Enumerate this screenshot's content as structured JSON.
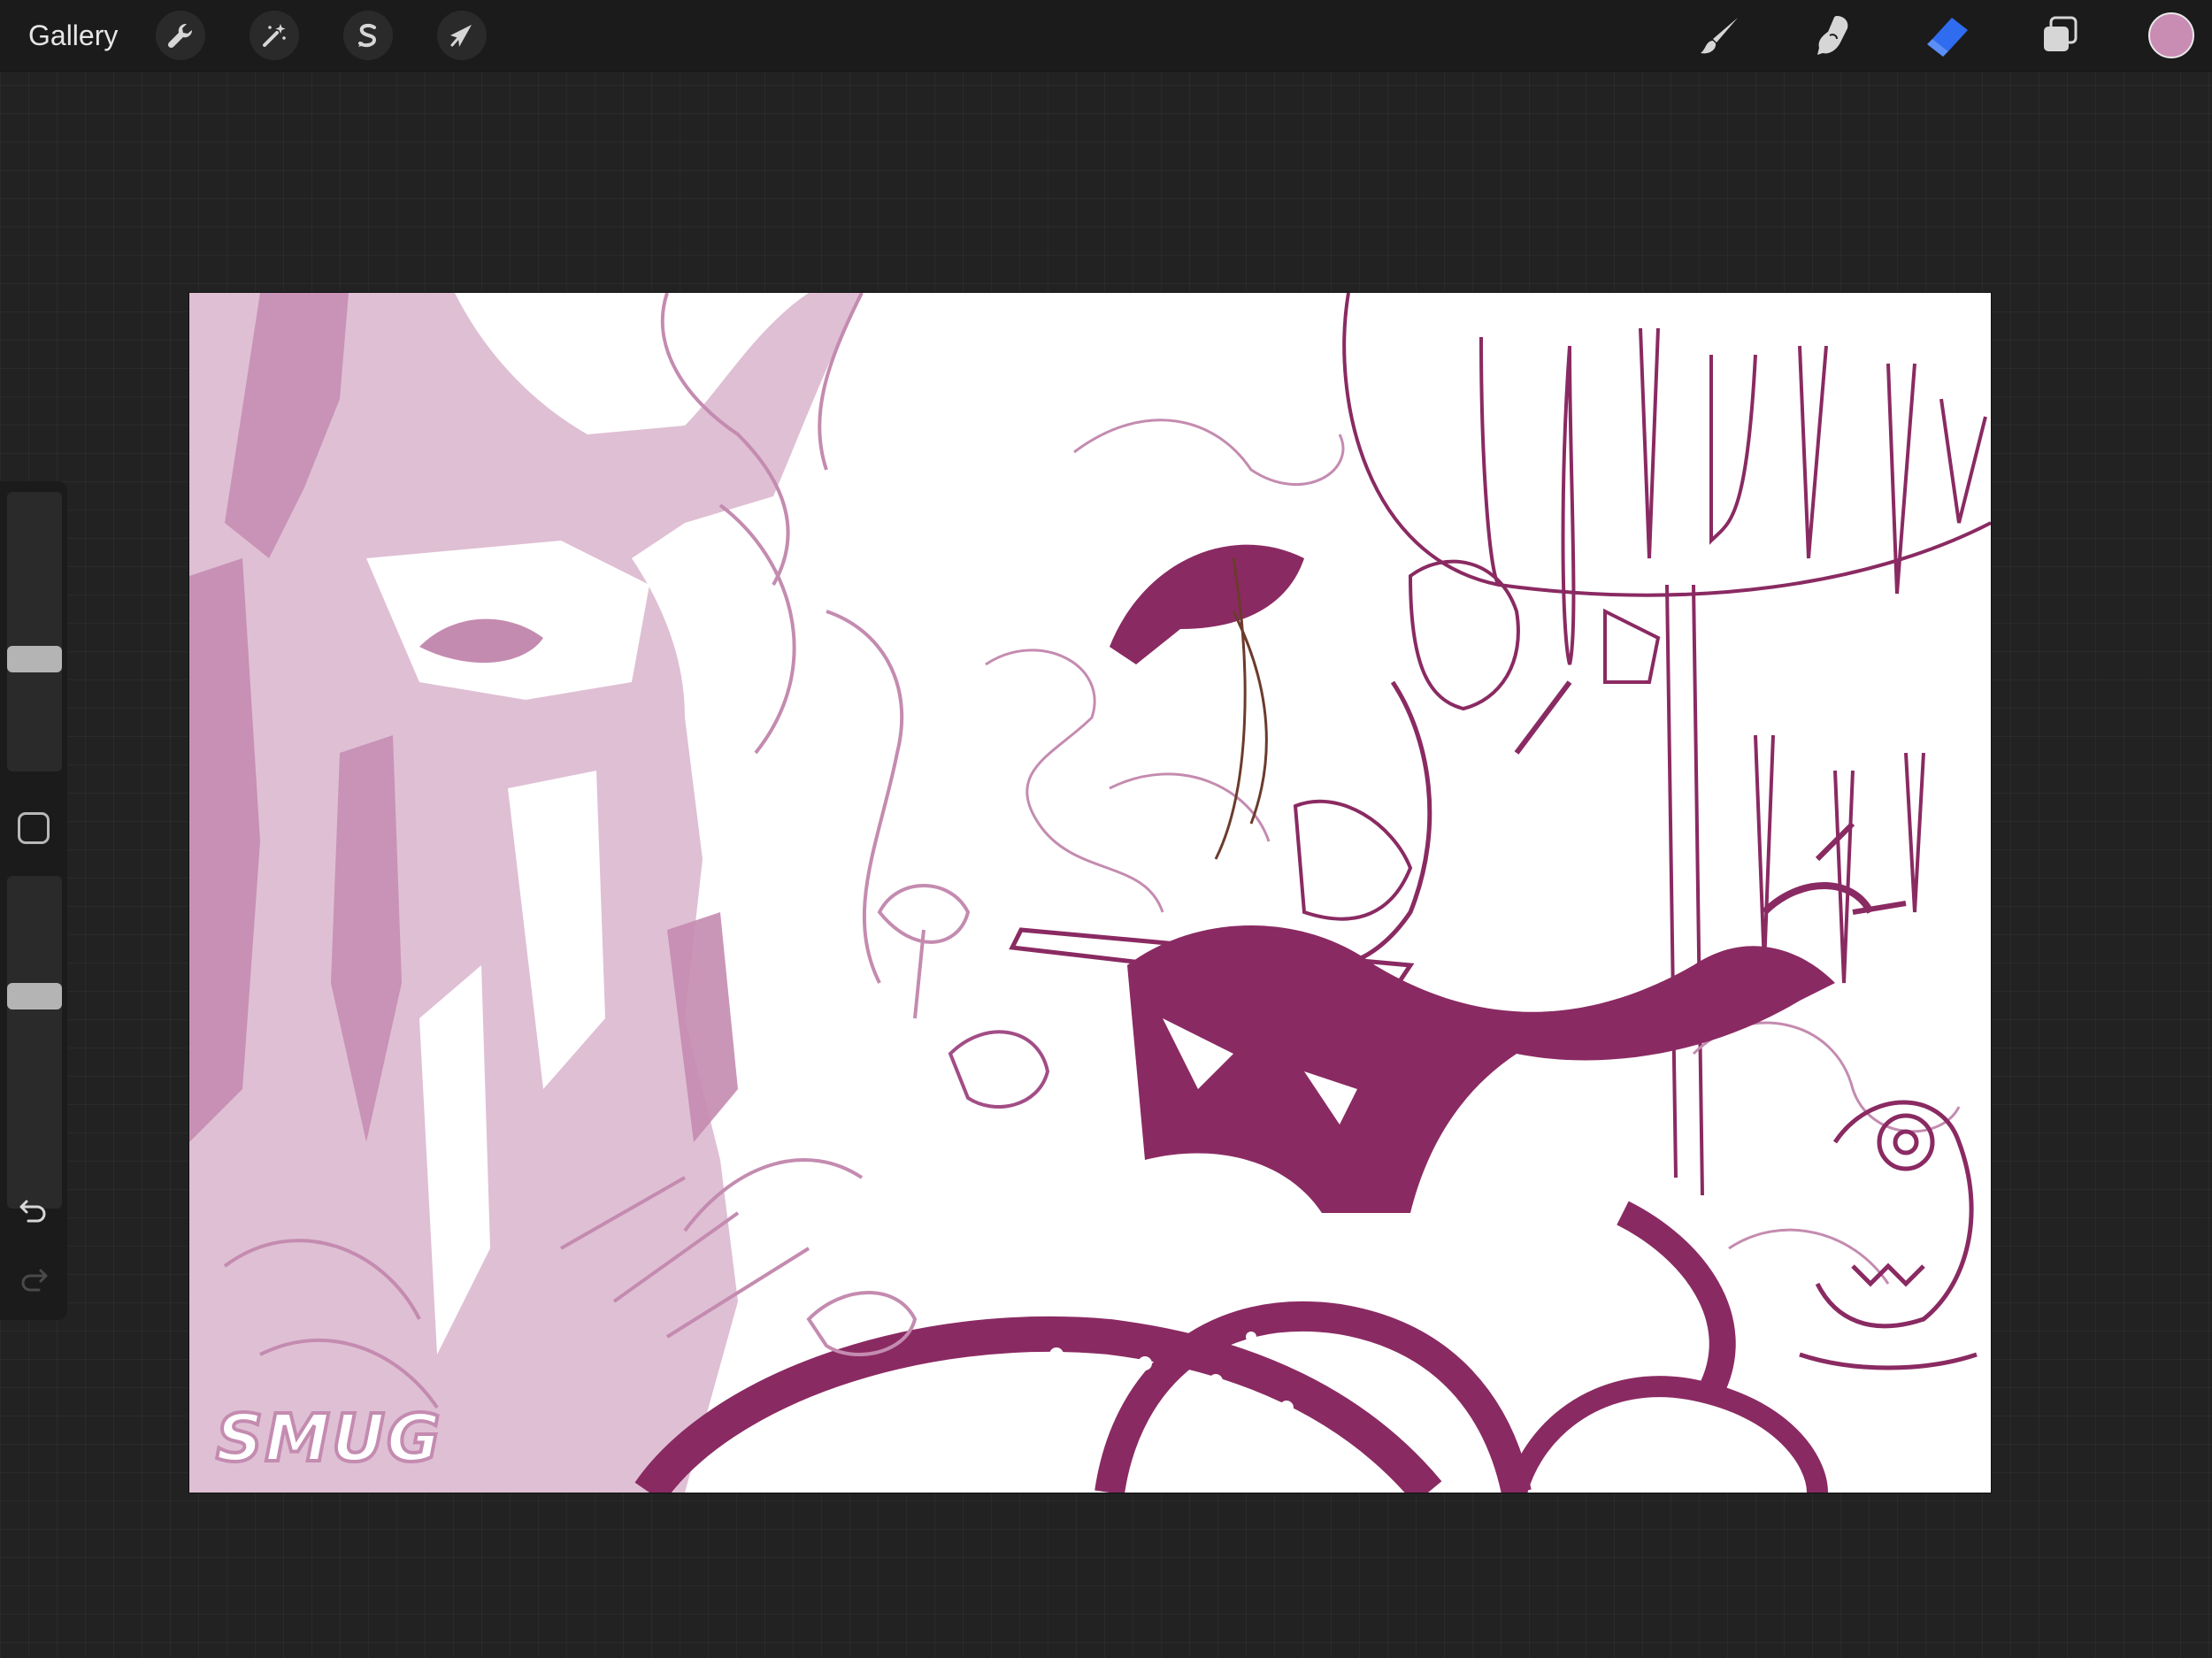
{
  "toolbar": {
    "gallery_label": "Gallery",
    "left_tools": [
      {
        "name": "actions",
        "icon": "wrench-icon"
      },
      {
        "name": "adjustments",
        "icon": "magic-wand-icon"
      },
      {
        "name": "selection",
        "icon": "selection-s-icon"
      },
      {
        "name": "transform",
        "icon": "arrow-cursor-icon"
      }
    ],
    "right_tools": [
      {
        "name": "brush",
        "icon": "brush-icon",
        "active": false
      },
      {
        "name": "smudge",
        "icon": "smudge-finger-icon",
        "active": false
      },
      {
        "name": "eraser",
        "icon": "eraser-icon",
        "active": true
      },
      {
        "name": "layers",
        "icon": "layers-icon",
        "active": false
      }
    ],
    "current_color": "#c98db4"
  },
  "sidebar": {
    "brush_size_level": 0.39,
    "opacity_level": 0.65,
    "modify_icon": "square-modify-icon",
    "undo_icon": "undo-icon",
    "redo_icon": "redo-icon",
    "redo_enabled": false
  },
  "canvas": {
    "artwork_text": "SMUG",
    "colors": {
      "ink_dark": "#8a2a62",
      "ink_mid": "#a24d86",
      "ink_light": "#c48bb0",
      "accent_brown": "#6b3b2c",
      "eraser_active": "#2f6cf0"
    }
  }
}
